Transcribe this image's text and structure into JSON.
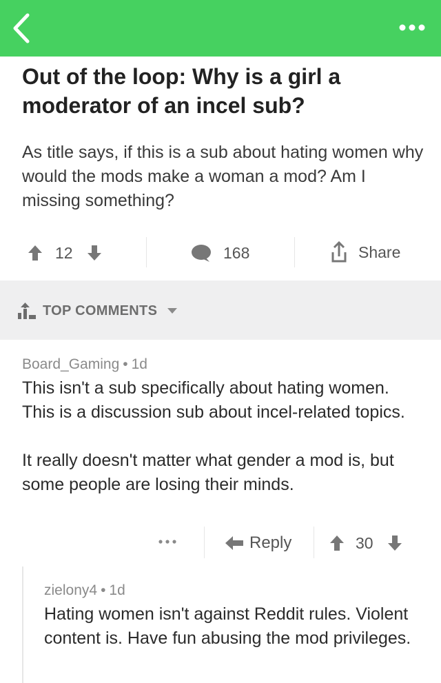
{
  "header": {
    "back_icon": "chevron-left-icon",
    "more_icon": "more-dots-icon",
    "bar_color": "#46d160"
  },
  "post": {
    "title": "Out of the loop: Why is a girl a moderator of an incel sub?",
    "body": "As title says, if this is a sub about hating women why would the mods make a woman a mod? Am I missing something?",
    "score": "12",
    "comment_count": "168",
    "share_label": "Share"
  },
  "sort": {
    "label": "TOP COMMENTS",
    "icon": "sort-bars-icon"
  },
  "comments": [
    {
      "author": "Board_Gaming",
      "separator": "•",
      "age": "1d",
      "paragraphs": [
        "This isn't a sub specifically about hating women. This is a discussion sub about incel-related topics.",
        "It really doesn't matter what gender a mod is, but some people are losing their minds."
      ],
      "more_label": "•••",
      "reply_label": "Reply",
      "score": "30"
    },
    {
      "author": "zielony4",
      "separator": "•",
      "age": "1d",
      "paragraphs": [
        "Hating women isn't against Reddit rules. Violent content is. Have fun abusing the mod privileges."
      ]
    }
  ]
}
